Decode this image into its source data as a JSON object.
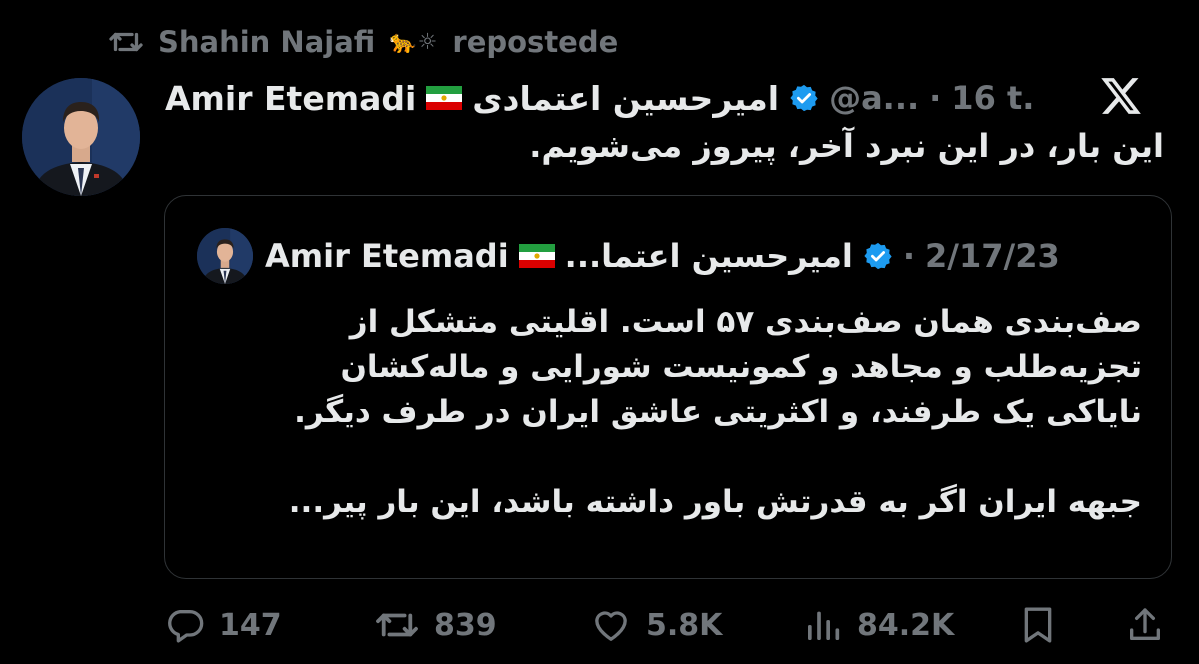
{
  "repost": {
    "user": "Shahin Najafi",
    "emoji": "🐆☼",
    "label": "repostede"
  },
  "tweet": {
    "author_name_en": "Amir Etemadi",
    "author_name_fa": "امیرحسین اعتمادی",
    "handle": "@a...",
    "separator": "·",
    "time": "16 t.",
    "text": "این بار، در این نبرد آخر، پیروز می‌شویم."
  },
  "quote": {
    "author_name_en": "Amir Etemadi",
    "author_name_fa": "امیرحسین اعتما...",
    "separator": "·",
    "date": "2/17/23",
    "paragraph_1": "صف‌بندی همان صف‌بندی ۵۷ است. اقلیتی متشکل از تجزیه‌طلب و مجاهد و کمونیست شورایی و ماله‌کشان نایاکی یک طرفند، و اکثریتی عاشق ایران در طرف دیگر.",
    "paragraph_2": "جبهه ایران اگر به قدرتش باور داشته باشد، این بار پیر..."
  },
  "actions": {
    "replies": "147",
    "reposts": "839",
    "likes": "5.8K",
    "views": "84.2K"
  },
  "icons": {
    "repost": "repost-icon",
    "verified": "verified-badge-icon",
    "flag": "iran-lion-sun-flag-icon",
    "x": "x-logo-icon",
    "reply": "reply-icon",
    "like": "heart-icon",
    "views": "views-bar-chart-icon",
    "bookmark": "bookmark-icon",
    "share": "share-icon"
  },
  "colors": {
    "background": "#000000",
    "text": "#e7e9ea",
    "muted": "#71767b",
    "verified": "#1d9bf0",
    "border": "#2f3336"
  }
}
